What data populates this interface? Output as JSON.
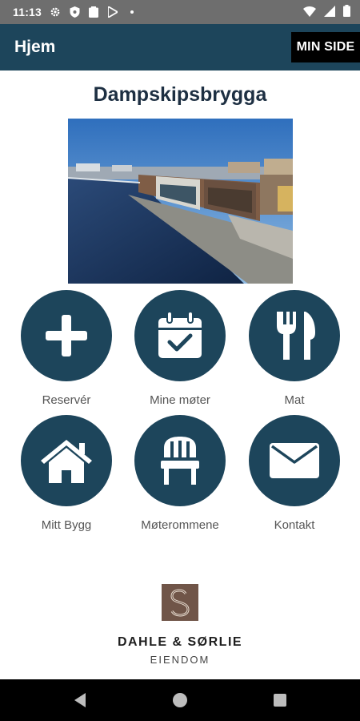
{
  "status_bar": {
    "time": "11:13",
    "icons": [
      "gear-icon",
      "shield-icon",
      "clipboard-icon",
      "play-store-icon",
      "dot-icon"
    ],
    "right_icons": [
      "wifi-icon",
      "signal-icon",
      "battery-icon"
    ]
  },
  "app_bar": {
    "title": "Hjem",
    "min_side_label": "MIN SIDE",
    "background": "#1d455b"
  },
  "page": {
    "title": "Dampskipsbrygga"
  },
  "tiles": [
    {
      "label": "Reservér",
      "icon": "plus-icon"
    },
    {
      "label": "Mine møter",
      "icon": "calendar-check-icon"
    },
    {
      "label": "Mat",
      "icon": "fork-knife-icon"
    },
    {
      "label": "Mitt Bygg",
      "icon": "house-icon"
    },
    {
      "label": "Møterommene",
      "icon": "chair-icon"
    },
    {
      "label": "Kontakt",
      "icon": "envelope-icon"
    }
  ],
  "logo": {
    "name": "DAHLE & SØRLIE",
    "sub": "EIENDOM",
    "mark_color": "#705548"
  },
  "nav": {
    "icons": [
      "back-icon",
      "home-icon",
      "recents-icon"
    ]
  }
}
